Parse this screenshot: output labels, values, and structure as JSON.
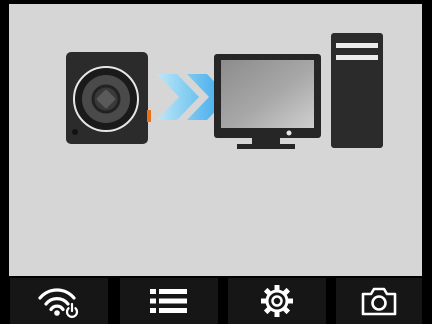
{
  "screen": {
    "background_color": "#d6d6d6",
    "illustration": {
      "source_device": "action-camera-icon",
      "transfer_indicator": "triple-chevron-arrow-icon",
      "target_device": "desktop-computer-icon",
      "arrow_color": "#1e90e6"
    }
  },
  "toolbar": {
    "background_color": "#000000",
    "buttons": [
      {
        "icon": "wifi-power-icon"
      },
      {
        "icon": "list-menu-icon"
      },
      {
        "icon": "settings-gear-icon"
      },
      {
        "icon": "camera-icon"
      }
    ]
  }
}
